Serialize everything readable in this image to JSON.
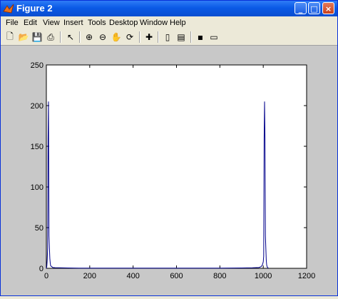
{
  "window": {
    "title": "Figure 2"
  },
  "menubar": [
    "File",
    "Edit",
    "View",
    "Insert",
    "Tools",
    "Desktop",
    "Window",
    "Help"
  ],
  "toolbar": {
    "tools": [
      "new-figure-icon",
      "open-file-icon",
      "save-icon",
      "print-icon",
      "select-arrow-icon",
      "zoom-in-icon",
      "zoom-out-icon",
      "pan-hand-icon",
      "rotate-3d-icon",
      "data-cursor-icon",
      "colorbar-icon",
      "legend-icon",
      "hide-plot-tools-icon",
      "show-plot-tools-icon"
    ]
  },
  "colors": {
    "line": "#00008b",
    "axes_bg": "#ffffff",
    "figure_bg": "#c8c8c8"
  },
  "chart_data": {
    "type": "line",
    "title": "",
    "xlabel": "",
    "ylabel": "",
    "xlim": [
      0,
      1200
    ],
    "ylim": [
      0,
      250
    ],
    "xticks": [
      0,
      200,
      400,
      600,
      800,
      1000,
      1200
    ],
    "yticks": [
      0,
      50,
      100,
      150,
      200,
      250
    ],
    "grid": false,
    "series": [
      {
        "x": [
          0,
          2,
          4,
          6,
          8,
          10,
          12,
          14,
          16,
          18,
          20,
          25,
          30,
          40,
          60,
          80,
          100,
          150,
          200,
          300,
          400,
          500,
          600,
          700,
          800,
          900,
          950,
          980,
          990,
          996,
          1000,
          1002,
          1004,
          1006,
          1008,
          1010,
          1012,
          1014,
          1016,
          1018,
          1020,
          1024
        ],
        "y": [
          0,
          2,
          10,
          25,
          160,
          205,
          40,
          25,
          12,
          6,
          3,
          2,
          1,
          0.8,
          0.6,
          0.5,
          0.4,
          0.3,
          0.3,
          0.2,
          0.2,
          0.2,
          0.2,
          0.2,
          0.3,
          0.4,
          0.6,
          1,
          2,
          4,
          8,
          15,
          160,
          205,
          160,
          40,
          25,
          10,
          4,
          2,
          1,
          0
        ]
      }
    ]
  }
}
